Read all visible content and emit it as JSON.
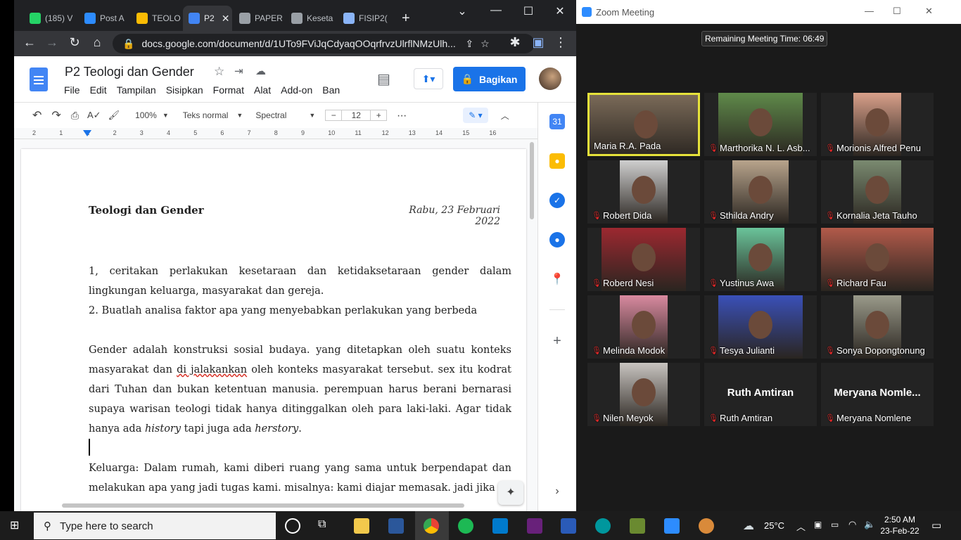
{
  "browser": {
    "tabs": [
      {
        "label": "(185) V",
        "icon": "whatsapp-icon",
        "color": "#25d366"
      },
      {
        "label": "Post A",
        "icon": "zoom-icon",
        "color": "#2d8cff"
      },
      {
        "label": "TEOLO",
        "icon": "drive-icon",
        "color": "#fbbc04"
      },
      {
        "label": "P2",
        "icon": "docs-icon",
        "color": "#4285f4"
      },
      {
        "label": "PAPER",
        "icon": "globe-icon",
        "color": "#9aa0a6"
      },
      {
        "label": "Keseta",
        "icon": "chat-icon",
        "color": "#9aa0a6"
      },
      {
        "label": "FISIP2(",
        "icon": "file-icon",
        "color": "#8ab4f8"
      }
    ],
    "new_tab": "+",
    "url": "docs.google.com/document/d/1UTo9FViJqCdyaqOOqrfrvzUlrflNMzUlh..."
  },
  "docs": {
    "title": "P2 Teologi dan Gender",
    "menus": [
      "File",
      "Edit",
      "Tampilan",
      "Sisipkan",
      "Format",
      "Alat",
      "Add-on",
      "Ban"
    ],
    "share_label": "Bagikan",
    "zoom": "100%",
    "style": "Teks normal",
    "font": "Spectral",
    "font_size": "12",
    "ruler_ticks": [
      "2",
      "1",
      "1",
      "2",
      "3",
      "4",
      "5",
      "6",
      "7",
      "8",
      "9",
      "10",
      "11",
      "12",
      "13",
      "14",
      "15",
      "16"
    ],
    "heading": "Teologi dan Gender",
    "date": "Rabu, 23 Februari 2022",
    "q1": "1, ceritakan perlakukan kesetaraan dan ketidaksetaraan gender dalam lingkungan keluarga, masyarakat dan gereja.",
    "q2": "2. Buatlah analisa faktor apa yang menyebabkan perlakukan yang berbeda",
    "p1_a": "Gender adalah konstruksi sosial budaya. yang ditetapkan oleh suatu konteks masyarakat dan ",
    "p1_err": "di jalakankan",
    "p1_b": " oleh konteks masyarakat tersebut. sex itu kodrat dari Tuhan dan bukan ketentuan manusia. perempuan harus berani bernarasi supaya warisan teologi tidak hanya ditinggalkan oleh para laki-laki. Agar tidak hanya ada ",
    "p1_i1": "history",
    "p1_c": " tapi juga ada ",
    "p1_i2": "herstory",
    "p1_d": ".",
    "p2": "Keluarga: Dalam rumah, kami diberi ruang yang sama untuk berpendapat dan melakukan apa yang jadi tugas kami. misalnya: kami diajar memasak. jadi jika a"
  },
  "zoom": {
    "window_title": "Zoom Meeting",
    "remaining": "Remaining Meeting Time: 06:49",
    "participants": [
      {
        "name": "Maria R.A. Pada",
        "muted": false,
        "active": true,
        "cam": "#7a6a58"
      },
      {
        "name": "Marthorika N. L. Asb...",
        "muted": true,
        "cam": "#5f8a4a"
      },
      {
        "name": "Morionis Alfred Penu",
        "muted": true,
        "cam": "#d9a08a"
      },
      {
        "name": "Robert Dida",
        "muted": true,
        "cam": "#cfcfcf"
      },
      {
        "name": "Sthilda Andry",
        "muted": true,
        "cam": "#b8a48c"
      },
      {
        "name": "Kornalia Jeta Tauho",
        "muted": true,
        "cam": "#7a8a70"
      },
      {
        "name": "Roberd Nesi",
        "muted": true,
        "cam": "#9c2830"
      },
      {
        "name": "Yustinus Awa",
        "muted": true,
        "cam": "#6ac49a"
      },
      {
        "name": "Richard Fau",
        "muted": true,
        "cam": "#b25a4a"
      },
      {
        "name": "Melinda Modok",
        "muted": true,
        "cam": "#d98aa0"
      },
      {
        "name": "Tesya Julianti",
        "muted": true,
        "cam": "#3a50b8"
      },
      {
        "name": "Sonya Dopongtonung",
        "muted": true,
        "cam": "#9a9a8a"
      },
      {
        "name": "Nilen Meyok",
        "muted": true,
        "cam": "#c8c4c0"
      },
      {
        "name": "Ruth Amtiran",
        "muted": true,
        "big": "Ruth Amtiran"
      },
      {
        "name": "Meryana Nomlene",
        "muted": true,
        "big": "Meryana  Nomle..."
      }
    ]
  },
  "taskbar": {
    "search_placeholder": "Type here to search",
    "weather": "25°C",
    "time": "2:50 AM",
    "date": "23-Feb-22"
  }
}
